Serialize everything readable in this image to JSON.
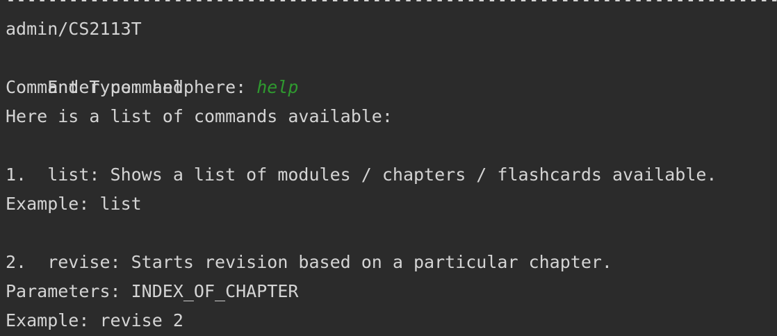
{
  "console": {
    "separator": "--------------------------------------------------------------------------------------------------------",
    "prompt_path": "admin/CS2113T",
    "prompt_label": "Enter command here: ",
    "user_input": "help",
    "command_type": "Command Type: help",
    "intro": "Here is a list of commands available:",
    "commands": [
      {
        "line": "1.  list: Shows a list of modules / chapters / flashcards available.",
        "example": "Example: list"
      },
      {
        "line": "2.  revise: Starts revision based on a particular chapter.",
        "parameters": "Parameters: INDEX_OF_CHAPTER",
        "example": "Example: revise 2"
      }
    ],
    "input_color": "#2f9a2f",
    "text_color": "#d4d4d4",
    "background": "#2b2b2b"
  }
}
